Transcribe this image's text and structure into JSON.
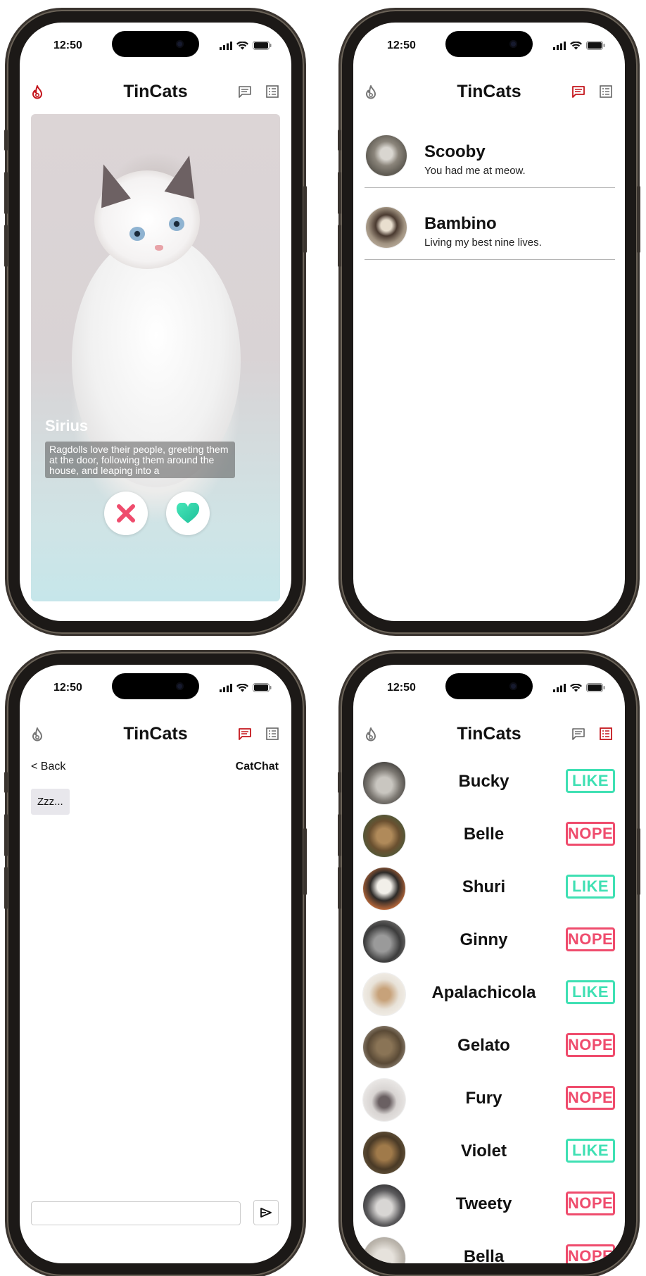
{
  "app": {
    "title": "TinCats",
    "time": "12:50"
  },
  "colors": {
    "accent_red": "#c4161c",
    "like": "#3fe0b3",
    "nope": "#ef4c6d"
  },
  "icons": [
    "flame-icon",
    "chat-icon",
    "list-icon",
    "signal-icon",
    "wifi-icon",
    "battery-icon",
    "close-icon",
    "heart-icon",
    "send-icon"
  ],
  "discover": {
    "cat_name": "Sirius",
    "cat_description": "Ragdolls love their people, greeting them at the door, following them around the house, and leaping into a"
  },
  "matches": [
    {
      "name": "Scooby",
      "bio": "You had me at meow."
    },
    {
      "name": "Bambino",
      "bio": "Living my best nine lives."
    }
  ],
  "chat": {
    "back_label": "< Back",
    "title": "CatChat",
    "messages": [
      "Zzz..."
    ],
    "input_placeholder": ""
  },
  "likes": [
    {
      "name": "Bucky",
      "status": "LIKE"
    },
    {
      "name": "Belle",
      "status": "NOPE"
    },
    {
      "name": "Shuri",
      "status": "LIKE"
    },
    {
      "name": "Ginny",
      "status": "NOPE"
    },
    {
      "name": "Apalachicola",
      "status": "LIKE"
    },
    {
      "name": "Gelato",
      "status": "NOPE"
    },
    {
      "name": "Fury",
      "status": "NOPE"
    },
    {
      "name": "Violet",
      "status": "LIKE"
    },
    {
      "name": "Tweety",
      "status": "NOPE"
    },
    {
      "name": "Bella",
      "status": "NOPE"
    }
  ]
}
